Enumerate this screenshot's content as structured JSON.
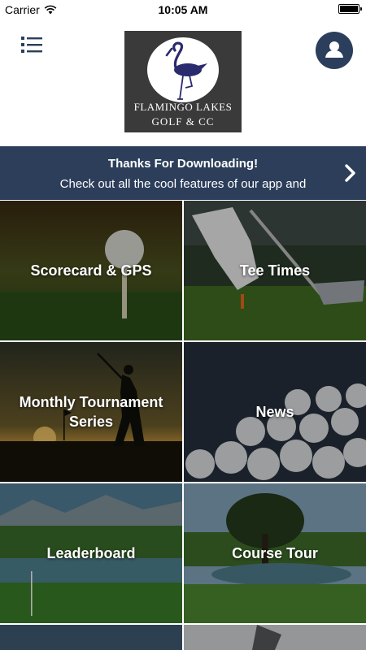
{
  "status_bar": {
    "carrier": "Carrier",
    "time": "10:05 AM"
  },
  "header": {
    "logo": {
      "line1": "FLAMINGO LAKES",
      "line2": "GOLF & CC"
    }
  },
  "banner": {
    "title": "Thanks For Downloading!",
    "message": "Check out all the cool features of our app and"
  },
  "tiles": [
    {
      "label": "Scorecard & GPS"
    },
    {
      "label": "Tee Times"
    },
    {
      "label": "Monthly Tournament Series"
    },
    {
      "label": "News"
    },
    {
      "label": "Leaderboard"
    },
    {
      "label": "Course Tour"
    }
  ],
  "colors": {
    "navy": "#2c3e5a",
    "profile_button": "#2b3e5c",
    "logo_bg": "#3a3a3a",
    "flamingo": "#2a2a6e"
  },
  "icons": [
    "wifi-icon",
    "battery-icon",
    "menu-icon",
    "user-icon",
    "flamingo-icon",
    "chevron-right-icon"
  ]
}
